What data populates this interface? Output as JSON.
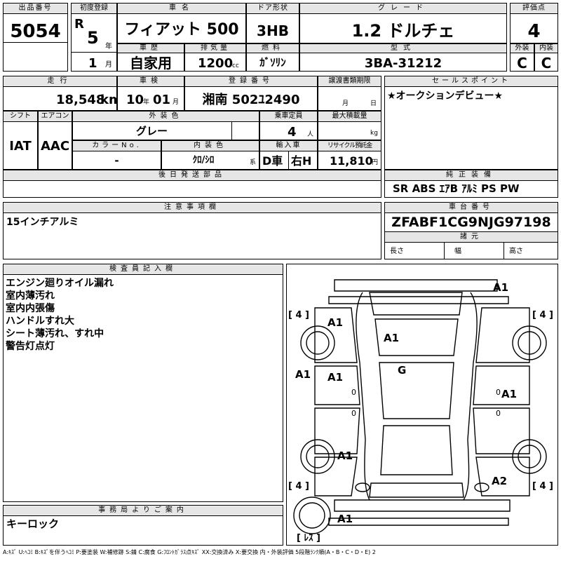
{
  "top": {
    "lot_no_label": "出品番号",
    "lot_no": "5054",
    "first_reg_label": "初度登録",
    "era": "R",
    "year": "5",
    "year_unit": "年",
    "month": "1",
    "month_unit": "月",
    "car_name_label": "車名",
    "car_name": "フィアット 500",
    "door_label": "ドア形状",
    "door": "3HB",
    "grade_label": "グレード",
    "grade": "1.2 ドルチェ",
    "score_label": "評価点",
    "score": "4",
    "history_label": "車歴",
    "history": "自家用",
    "displacement_label": "排気量",
    "displacement": "1200",
    "cc": "cc",
    "fuel_label": "燃料",
    "fuel": "ｶﾞｿﾘﾝ",
    "model_label": "型式",
    "model": "3BA-31212",
    "ext_label": "外装",
    "ext": "C",
    "int_label": "内装",
    "int": "C"
  },
  "second": {
    "mileage_label": "走行",
    "mileage": "18,548",
    "km": "km",
    "inspection_label": "車検",
    "insp_year": "10",
    "insp_year_unit": "年",
    "insp_month": "01",
    "insp_month_unit": "月",
    "plate_label": "登録番号",
    "plate": "湘南 502ﾕ2490",
    "transfer_label": "譲渡書類期限",
    "transfer_month": "月",
    "transfer_day": "日",
    "shift_label": "シフト",
    "shift": "IAT",
    "ac_label": "エアコン",
    "ac": "AAC",
    "color_label": "外装色",
    "color": "グレー",
    "capacity_label": "乗車定員",
    "capacity": "4",
    "capacity_unit": "人",
    "load_label": "最大積載量",
    "load_unit": "kg",
    "color_no_label": "カラーNo.",
    "color_no": "-",
    "interior_label": "内装色",
    "interior": "ｸﾛ/ｼﾛ",
    "interior_unit": "系",
    "import_label": "輸入車",
    "import": "D車",
    "handle": "右H",
    "recycle_label": "リサイクル預託金",
    "recycle": "11,810",
    "recycle_unit": "円",
    "later_label": "後日発送部品"
  },
  "sales": {
    "label": "セールスポイント",
    "text": "★オークションデビュー★"
  },
  "equipment": {
    "label": "純正装備",
    "text": "SR ABS ｴｱB ｱﾙﾐ PS PW"
  },
  "notes": {
    "label": "注意事項欄",
    "text": "15インチアルミ"
  },
  "chassis": {
    "label": "車台番号",
    "number": "ZFABF1CG9NJG97198",
    "spec_label": "諸元",
    "length": "長さ",
    "width": "幅",
    "height": "高さ"
  },
  "inspector": {
    "label": "検査員記入欄",
    "lines": [
      "エンジン廻りオイル漏れ",
      "室内薄汚れ",
      "室内内張傷",
      "ハンドルすれ大",
      "シート薄汚れ、すれ中",
      "警告灯点灯"
    ]
  },
  "office": {
    "label": "事務局よりご案内",
    "text": "キーロック"
  },
  "diagram": {
    "marks": [
      "A1",
      "A1",
      "A1",
      "G",
      "A1",
      "A1",
      "A1",
      "A1",
      "A2",
      "A1"
    ],
    "tires": [
      "[ 4 ]",
      "[ 4 ]",
      "[ 4 ]",
      "[ 4 ]",
      "[ ﾚｽ ]"
    ],
    "zeros": [
      "0",
      "0",
      "0",
      "0"
    ]
  },
  "legend": "A:ｷｽﾞ U:ﾍｺﾐ B:ｷｽﾞを伴うﾍｺﾐ P:要塗装 W:補修跡 S:錆 C:腐食 G:ﾌﾛﾝﾄｶﾞﾗｽ点ｷｽﾞ XX:交換済み X:要交換 内・外装評価 5段階ﾗﾝｸ順(A・B・C・D・E) 2"
}
